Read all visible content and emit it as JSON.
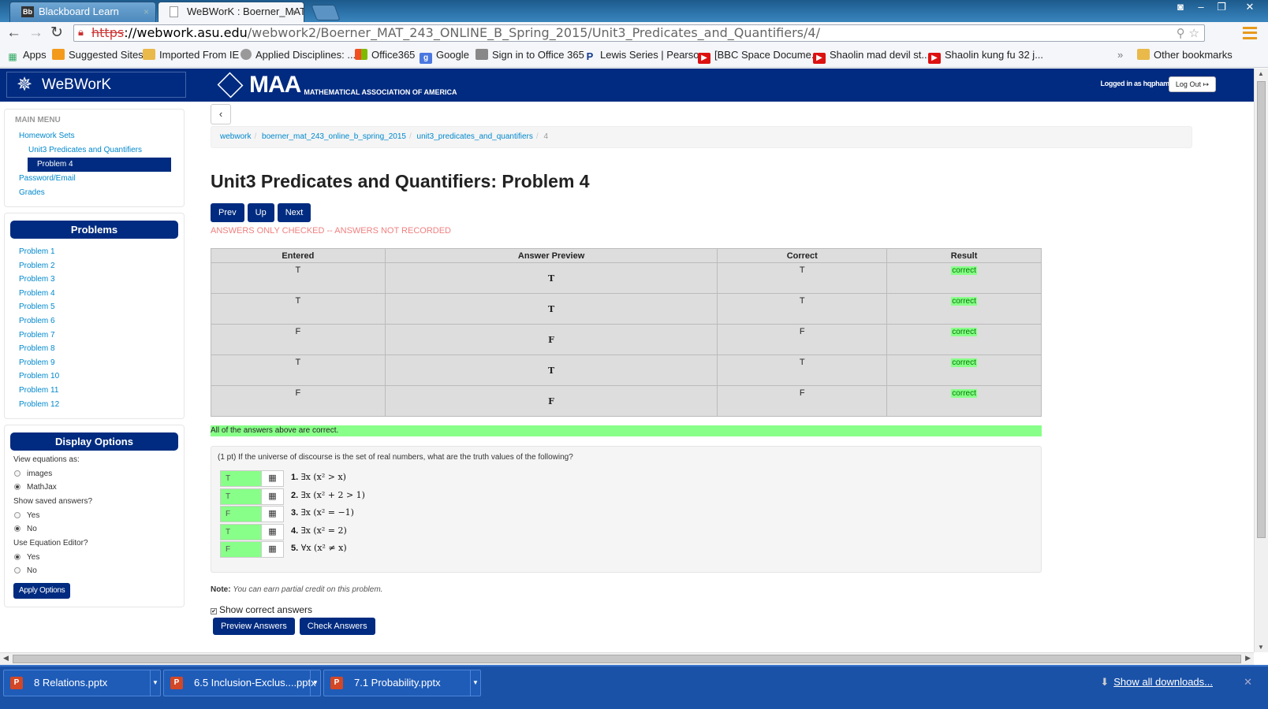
{
  "browser": {
    "tabs": [
      {
        "label": "Blackboard Learn",
        "icon": "Bb"
      },
      {
        "label": "WeBWorK : Boerner_MAT_",
        "icon": "doc"
      }
    ],
    "url": {
      "scheme": "https",
      "domain": "://webwork.asu.edu",
      "path": "/webwork2/Boerner_MAT_243_ONLINE_B_Spring_2015/Unit3_Predicates_and_Quantifiers/4/"
    },
    "bookmarks": [
      {
        "label": "Apps",
        "icon": "apps-icon"
      },
      {
        "label": "Suggested Sites",
        "icon": "suggested-icon"
      },
      {
        "label": "Imported From IE",
        "icon": "folder-icon"
      },
      {
        "label": "Applied Disciplines: ...",
        "icon": "circle-icon"
      },
      {
        "label": "Office365",
        "icon": "office-icon"
      },
      {
        "label": "Google",
        "icon": "google-icon"
      },
      {
        "label": "Sign in to Office 365",
        "icon": "doc-icon"
      },
      {
        "label": "Lewis Series | Pearson",
        "icon": "pearson-icon"
      },
      {
        "label": "[BBC Space Docume...",
        "icon": "youtube-icon"
      },
      {
        "label": "Shaolin mad devil st...",
        "icon": "youtube-icon"
      },
      {
        "label": "Shaolin kung fu 32 j...",
        "icon": "youtube-icon"
      }
    ],
    "more_bookmarks": "»",
    "other_bookmarks": "Other bookmarks"
  },
  "header": {
    "brand": "WeBWorK",
    "maa_short": "MAA",
    "maa_long": "MATHEMATICAL ASSOCIATION OF AMERICA",
    "logged_in": "Logged in as hqpham.",
    "logout": "Log Out"
  },
  "sidebar": {
    "main_menu": "MAIN MENU",
    "homework_sets": "Homework Sets",
    "set_name": "Unit3 Predicates and Quantifiers",
    "current_problem": "Problem 4",
    "password_email": "Password/Email",
    "grades": "Grades",
    "problems_title": "Problems",
    "problems": [
      "Problem 1",
      "Problem 2",
      "Problem 3",
      "Problem 4",
      "Problem 5",
      "Problem 6",
      "Problem 7",
      "Problem 8",
      "Problem 9",
      "Problem 10",
      "Problem 11",
      "Problem 12"
    ],
    "display_title": "Display Options",
    "view_eq_label": "View equations as:",
    "view_eq_options": [
      "images",
      "MathJax"
    ],
    "view_eq_selected": "MathJax",
    "saved_label": "Show saved answers?",
    "saved_options": [
      "Yes",
      "No"
    ],
    "saved_selected": "No",
    "editor_label": "Use Equation Editor?",
    "editor_options": [
      "Yes",
      "No"
    ],
    "editor_selected": "Yes",
    "apply": "Apply Options"
  },
  "main": {
    "breadcrumbs": [
      "webwork",
      "boerner_mat_243_online_b_spring_2015",
      "unit3_predicates_and_quantifiers"
    ],
    "breadcrumb_current": "4",
    "title": "Unit3 Predicates and Quantifiers: Problem 4",
    "nav": {
      "prev": "Prev",
      "up": "Up",
      "next": "Next"
    },
    "status_msg": "ANSWERS ONLY CHECKED -- ANSWERS NOT RECORDED",
    "results_headers": [
      "Entered",
      "Answer Preview",
      "Correct",
      "Result"
    ],
    "results": [
      {
        "entered": "T",
        "preview": "T",
        "correct": "T",
        "result": "correct"
      },
      {
        "entered": "T",
        "preview": "T",
        "correct": "T",
        "result": "correct"
      },
      {
        "entered": "F",
        "preview": "F",
        "correct": "F",
        "result": "correct"
      },
      {
        "entered": "T",
        "preview": "T",
        "correct": "T",
        "result": "correct"
      },
      {
        "entered": "F",
        "preview": "F",
        "correct": "F",
        "result": "correct"
      }
    ],
    "all_correct": "All of the answers above are correct.",
    "question": "(1 pt) If the universe of discourse is the set of real numbers, what are the truth values of the following?",
    "answers": [
      {
        "value": "T",
        "num": "1.",
        "stmt": "∃x (x² > x)"
      },
      {
        "value": "T",
        "num": "2.",
        "stmt": "∃x (x² + 2 > 1)"
      },
      {
        "value": "F",
        "num": "3.",
        "stmt": "∃x (x² = −1)"
      },
      {
        "value": "T",
        "num": "4.",
        "stmt": "∃x (x² = 2)"
      },
      {
        "value": "F",
        "num": "5.",
        "stmt": "∀x (x² ≠ x)"
      }
    ],
    "note_label": "Note:",
    "note_text": "You can earn partial credit on this problem.",
    "show_correct": "Show correct answers",
    "preview_btn": "Preview Answers",
    "check_btn": "Check Answers"
  },
  "downloads": {
    "items": [
      "8 Relations.pptx",
      "6.5 Inclusion-Exclus....pptx",
      "7.1 Probability.pptx"
    ],
    "show_all": "Show all downloads..."
  }
}
